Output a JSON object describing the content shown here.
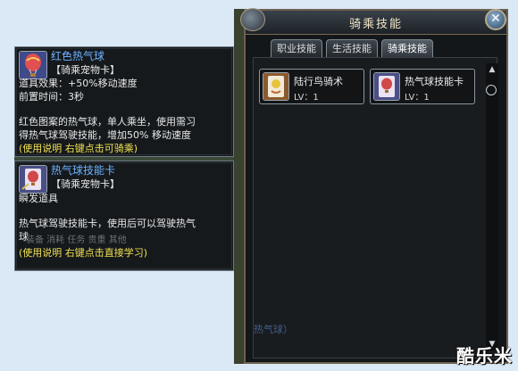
{
  "tooltip1": {
    "name": "红色热气球",
    "category": "【骑乘宠物卡】",
    "effect": "道具效果：+50%移动速度",
    "cast_time": "前置时间：3秒",
    "desc_line1": "红色图案的热气球，单人乘坐，使用需习",
    "desc_line2": "得热气球驾驶技能，增加50% 移动速度",
    "usage": "(使用说明 右键点击可骑乘)"
  },
  "tooltip2": {
    "name": "热气球技能卡",
    "category": "【骑乘宠物卡】",
    "type": "瞬发道具",
    "desc_line1": "热气球驾驶技能卡，使用后可以驾驶热气",
    "desc_line2": "球",
    "usage": "(使用说明 右键点击直接学习)",
    "bg_tabs": "装备  消耗  任务  贵重  其他"
  },
  "panel": {
    "title": "骑乘技能",
    "tabs": [
      "职业技能",
      "生活技能",
      "骑乘技能"
    ],
    "active_tab": "骑乘技能",
    "skills": [
      {
        "name": "陆行鸟骑术",
        "level": "LV：1",
        "icon": "chocobo-skill-icon"
      },
      {
        "name": "热气球技能卡",
        "level": "LV：1",
        "icon": "balloon-skill-icon"
      }
    ],
    "bg_text": "热气球）"
  },
  "watermark": "酷乐米",
  "colors": {
    "item_name": "#6fb3ff",
    "usage_hint": "#f0e050",
    "title": "#f3e6c8"
  }
}
